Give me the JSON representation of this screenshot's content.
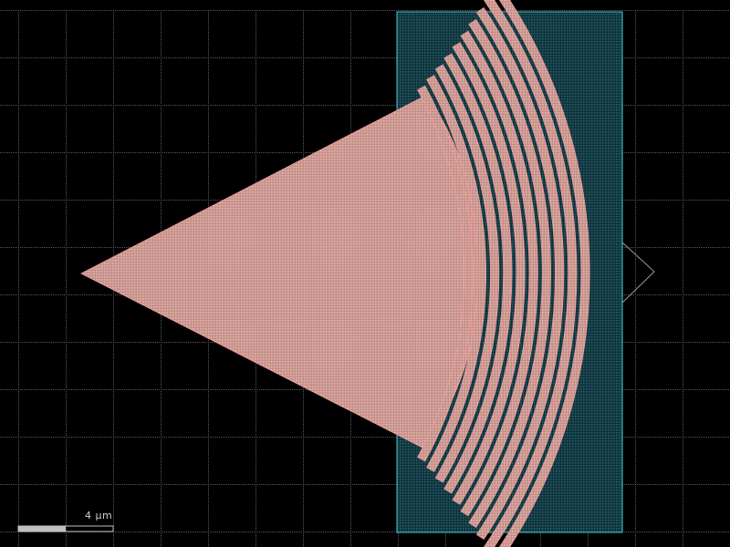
{
  "viewer": {
    "background_color": "#000000",
    "grid_dot_color": "#5a5a5a"
  },
  "layout_colors": {
    "taper_fill": "#d9a7a0",
    "taper_outline": "#ff9d9d",
    "slab_fill": "#1e4c55",
    "slab_outline": "#3ec9d6",
    "waveguide_outline": "#3ec9d6"
  },
  "components": {
    "taper_name": "grating-coupler-taper",
    "slab_name": "slab-region",
    "port_name": "optical-port",
    "grating_teeth_count": 10
  },
  "scale_bar": {
    "label": "4  µm",
    "value_um": 4
  }
}
